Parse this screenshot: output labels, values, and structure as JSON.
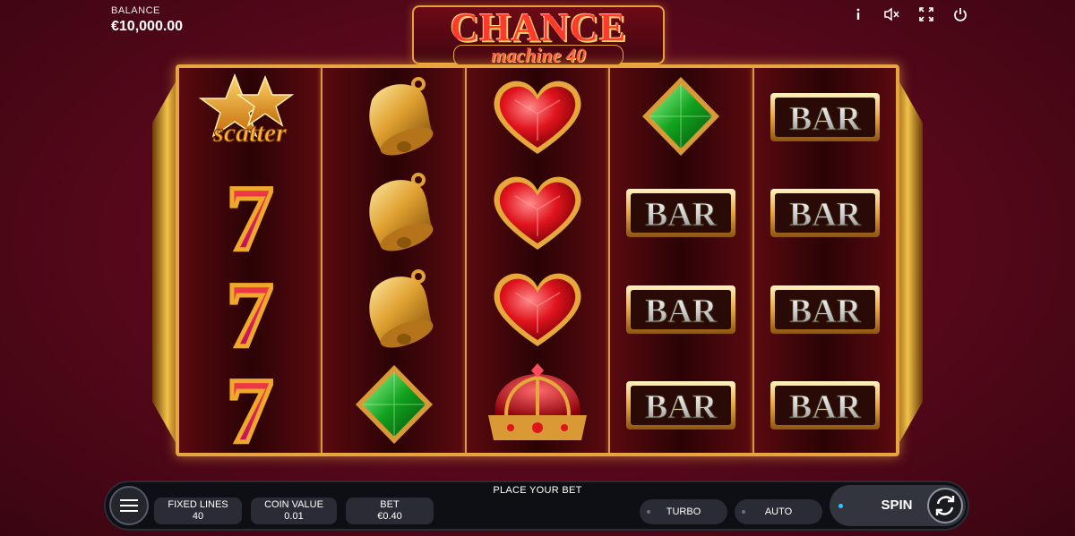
{
  "balance": {
    "label": "BALANCE",
    "value": "€10,000.00"
  },
  "top_icons": [
    "info-icon",
    "sound-off-icon",
    "fullscreen-icon",
    "power-icon"
  ],
  "logo": {
    "title": "CHANCE",
    "subtitle": "machine 40"
  },
  "reels": [
    [
      "scatter",
      "seven",
      "seven",
      "seven"
    ],
    [
      "bell",
      "bell",
      "bell",
      "diamond"
    ],
    [
      "heart",
      "heart",
      "heart",
      "crown"
    ],
    [
      "diamond",
      "bar",
      "bar",
      "bar"
    ],
    [
      "bar",
      "bar",
      "bar",
      "bar"
    ]
  ],
  "symbols": {
    "scatter_text": "scatter",
    "bar_text": "BAR",
    "seven_text": "7"
  },
  "controls": {
    "place_bet": "PLACE YOUR BET",
    "fixed_lines_label": "FIXED LINES",
    "fixed_lines_value": "40",
    "coin_value_label": "COIN VALUE",
    "coin_value_value": "0.01",
    "bet_label": "BET",
    "bet_value": "€0.40",
    "turbo_label": "TURBO",
    "auto_label": "AUTO",
    "spin_label": "SPIN"
  },
  "colors": {
    "background": "#55081a",
    "frame_gold": "#e7a53f",
    "bar_panel": "#111218",
    "spin_indicator": "#2ec4ff"
  }
}
